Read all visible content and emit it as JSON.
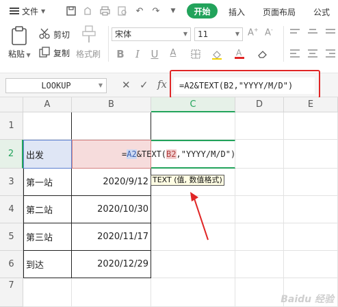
{
  "menu": {
    "file_label": "文件",
    "tabs": [
      {
        "label": "开始",
        "active": true
      },
      {
        "label": "插入",
        "active": false
      },
      {
        "label": "页面布局",
        "active": false
      },
      {
        "label": "公式",
        "active": false
      }
    ]
  },
  "ribbon": {
    "paste_label": "粘贴",
    "cut_label": "剪切",
    "copy_label": "复制",
    "format_painter_label": "格式刷",
    "font_name": "宋体",
    "font_size": "11"
  },
  "formula_bar": {
    "name_box": "LOOKUP",
    "fx": "fx",
    "formula": "=A2&TEXT(B2,\"YYYY/M/D\")"
  },
  "grid": {
    "columns": [
      "A",
      "B",
      "C",
      "D",
      "E"
    ],
    "rows": [
      "1",
      "2",
      "3",
      "4",
      "5",
      "6",
      "7"
    ],
    "cells": {
      "a2": "出发",
      "a3": "第一站",
      "a4": "第二站",
      "a5": "第三站",
      "a6": "到达",
      "b3": "2020/9/12",
      "b4": "2020/10/30",
      "b5": "2020/11/17",
      "b6": "2020/12/29"
    },
    "edit": {
      "prefix": "=",
      "ref_a": "A2",
      "mid": "&TEXT(",
      "ref_b": "B2",
      "suffix": ",\"YYYY/M/D\")"
    },
    "tooltip": "TEXT (值, 数值格式)"
  },
  "colors": {
    "accent": "#22a35b",
    "highlight": "#e02626",
    "ref_a_bg": "#cdd9f2",
    "ref_b_bg": "#f1cccc"
  }
}
